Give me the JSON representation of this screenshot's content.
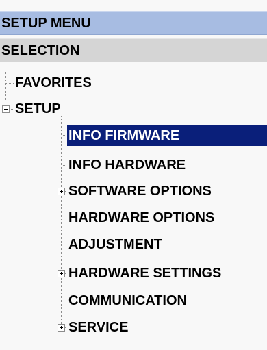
{
  "header": {
    "title": "SETUP MENU"
  },
  "selection_header": {
    "label": "SELECTION"
  },
  "tree": {
    "favorites": "FAVORITES",
    "setup": {
      "label": "SETUP",
      "expanded": true,
      "children": {
        "info_firmware": "INFO FIRMWARE",
        "info_hardware": "INFO HARDWARE",
        "software_options": "SOFTWARE OPTIONS",
        "hardware_options": "HARDWARE OPTIONS",
        "adjustment": "ADJUSTMENT",
        "hardware_settings": "HARDWARE SETTINGS",
        "communication": "COMMUNICATION",
        "service": "SERVICE"
      }
    },
    "selected_item": "INFO FIRMWARE"
  },
  "colors": {
    "header_background": "#a7bce2",
    "selection_background": "#d5d5d5",
    "selected_item_background": "#0a1f7a",
    "selected_item_text": "#ffffff",
    "tree_line": "#8c8c8c"
  },
  "icons": {
    "collapse": "minus-box-icon",
    "expand": "plus-box-icon"
  }
}
